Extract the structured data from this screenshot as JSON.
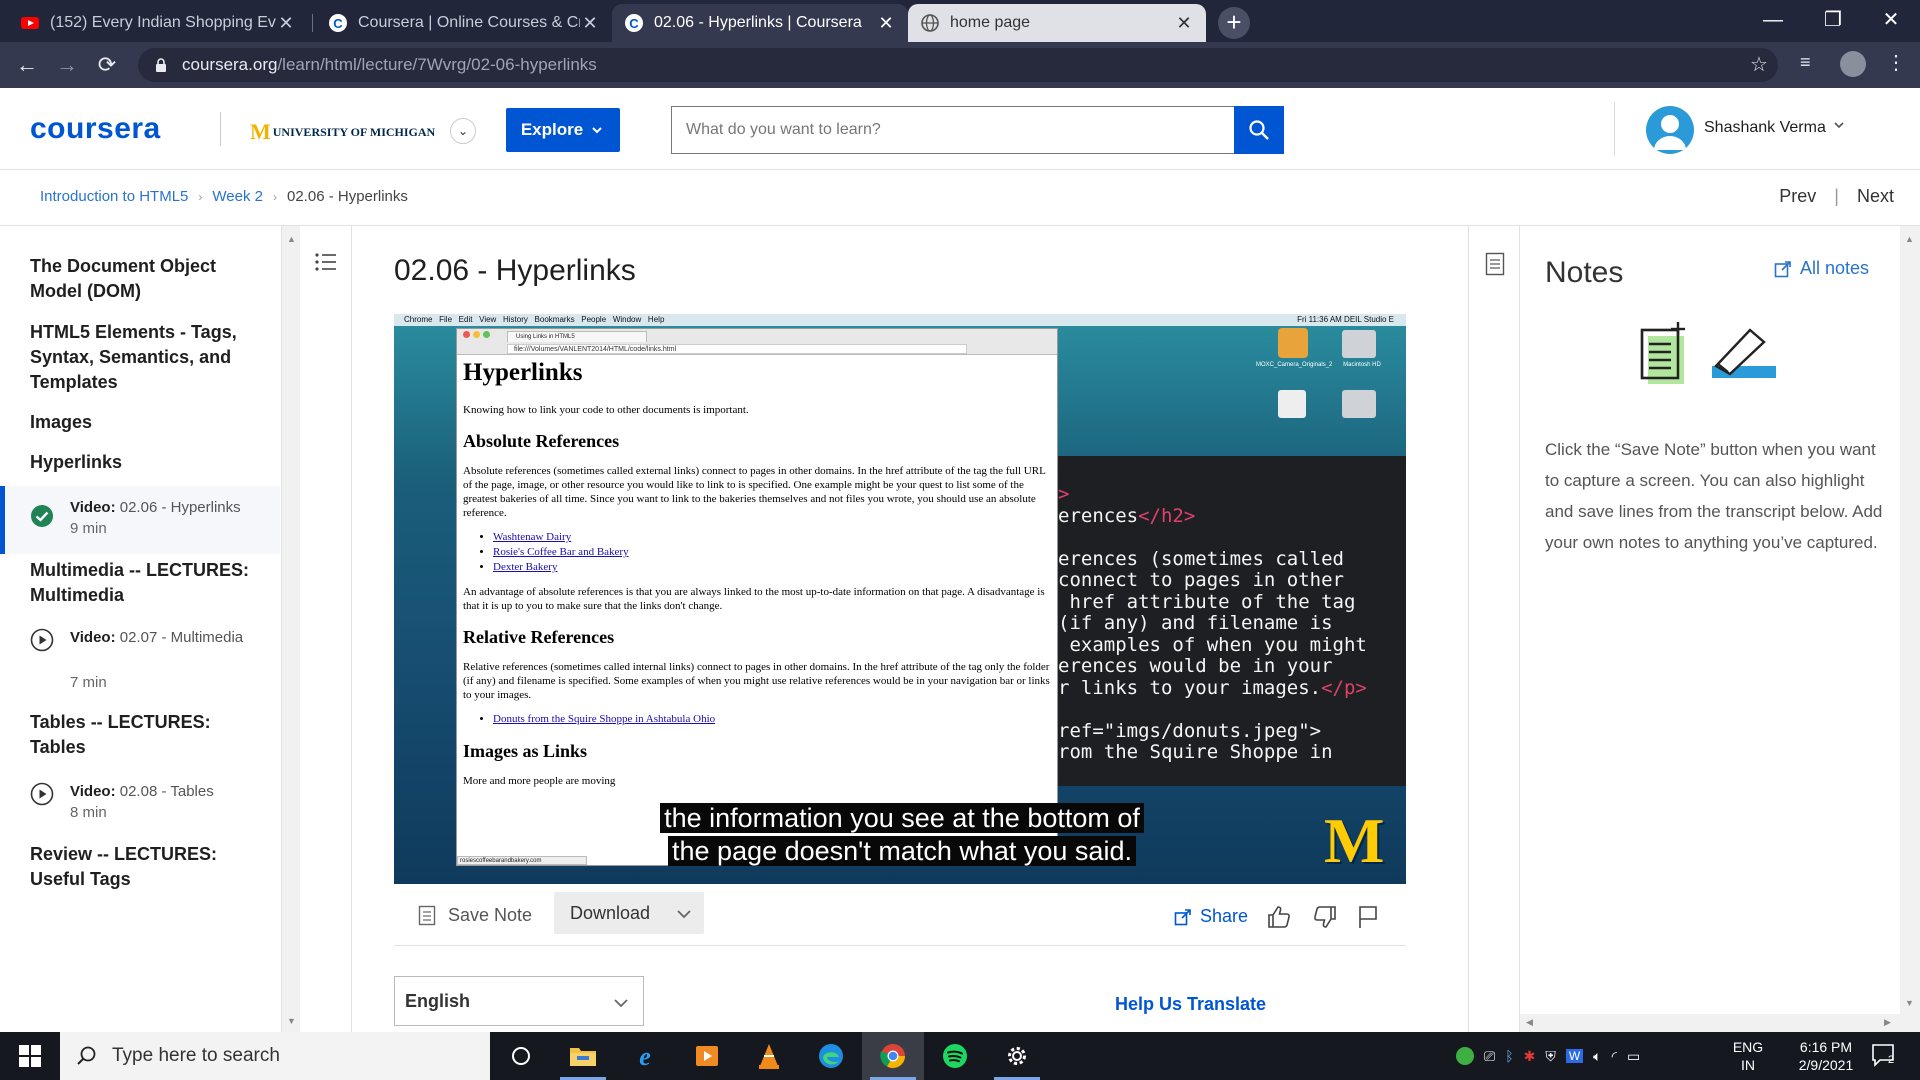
{
  "browser": {
    "tabs": [
      {
        "title": "(152) Every Indian Shopping Ever",
        "state": "inactive"
      },
      {
        "title": "Coursera | Online Courses & Credentials",
        "state": "inactive"
      },
      {
        "title": "02.06 - Hyperlinks | Coursera",
        "state": "active"
      },
      {
        "title": "home page",
        "state": "light"
      }
    ],
    "url_domain": "coursera.org",
    "url_path": "/learn/html/lecture/7Wvrg/02-06-hyperlinks"
  },
  "header": {
    "logo": "coursera",
    "partner_m": "M",
    "partner": "UNIVERSITY OF MICHIGAN",
    "explore_label": "Explore",
    "search_placeholder": "What do you want to learn?",
    "user_name": "Shashank Verma"
  },
  "breadcrumb": {
    "course": "Introduction to HTML5",
    "week": "Week 2",
    "current": "02.06 - Hyperlinks",
    "prev": "Prev",
    "next": "Next"
  },
  "sidebar": {
    "sections": [
      {
        "title": "The Document Object Model (DOM)"
      },
      {
        "title": "HTML5 Elements - Tags, Syntax, Semantics, and Templates"
      },
      {
        "title": "Images"
      },
      {
        "title": "Hyperlinks"
      },
      {
        "title": "Multimedia -- LECTURES: Multimedia"
      },
      {
        "title": "Tables -- LECTURES: Tables"
      },
      {
        "title": "Review -- LECTURES: Useful Tags"
      }
    ],
    "items": [
      {
        "kind": "Video:",
        "name": "02.06 - Hyperlinks",
        "duration": "9 min",
        "status": "completed"
      },
      {
        "kind": "Video:",
        "name": "02.07 - Multimedia",
        "duration": "7 min",
        "status": "play"
      },
      {
        "kind": "Video:",
        "name": "02.08 - Tables",
        "duration": "8 min",
        "status": "play"
      }
    ]
  },
  "main": {
    "title": "02.06 - Hyperlinks",
    "video": {
      "mac_menu": "Chrome   File   Edit   View   History   Bookmarks   People   Window   Help",
      "mac_clock": "Fri 11:36 AM   DEIL Studio E",
      "inner_tab": "Using Links in HTML5",
      "inner_url": "file:///Volumes/VANLENT2014/HTML/code/links.html",
      "page_h1": "Hyperlinks",
      "page_intro": "Knowing how to link your code to other documents is important.",
      "abs_h2": "Absolute References",
      "abs_p": "Absolute references (sometimes called external links) connect to pages in other domains. In the href attribute of the tag the full URL of the page, image, or other resource you would like to link to is specified. One example might be your quest to list some of the greatest bakeries of all time. Since you want to link to the bakeries themselves and not files you wrote, you should use an absolute reference.",
      "abs_links": [
        "Washtenaw Dairy",
        "Rosie's Coffee Bar and Bakery",
        "Dexter Bakery"
      ],
      "abs_p2": "An advantage of absolute references is that you are always linked to the most up-to-date information on that page. A disadvantage is that it is up to you to make sure that the links don't change.",
      "rel_h2": "Relative References",
      "rel_p": "Relative references (sometimes called internal links) connect to pages in other domains. In the href attribute of the tag only the folder (if any) and filename is specified. Some examples of when you might use relative references would be in your navigation bar or links to your images.",
      "rel_links": [
        "Donuts from the Squire Shoppe in Ashtabula Ohio"
      ],
      "img_h2": "Images as Links",
      "img_p": "More and more people are moving",
      "status_url": "rosiescoffeebarandbakery.com",
      "drive1": "MOXC_Camera_Originals_2",
      "drive2": "Macintosh HD",
      "caption_line1": "the information you see at the bottom of",
      "caption_line2": "the page doesn't match what you said.",
      "code_lines": [
        {
          "a": "",
          "tag": ">"
        },
        {
          "a": "erences",
          "tag": "</h2>"
        },
        {
          "a": "",
          "tag": ""
        },
        {
          "a": "erences (sometimes called",
          "tag": ""
        },
        {
          "a": "connect to pages in other",
          "tag": ""
        },
        {
          "a": " href attribute of the tag",
          "tag": ""
        },
        {
          "a": "(if any) and filename is",
          "tag": ""
        },
        {
          "a": " examples of when you might",
          "tag": ""
        },
        {
          "a": "erences would be in your",
          "tag": ""
        },
        {
          "a": "r links to your images.",
          "tag": "</p>"
        },
        {
          "a": "",
          "tag": ""
        },
        {
          "a": "ref=\"imgs/donuts.jpeg\">",
          "tag": ""
        },
        {
          "a": "rom the Squire Shoppe in",
          "tag": ""
        }
      ]
    },
    "save_note": "Save Note",
    "download": "Download",
    "share": "Share",
    "language": "English",
    "help_translate": "Help Us Translate"
  },
  "notes": {
    "title": "Notes",
    "all_notes": "All notes",
    "help_text": "Click the “Save Note” button when you want to capture a screen. You can also highlight and save lines from the transcript below. Add your own notes to anything you’ve captured."
  },
  "taskbar": {
    "search_placeholder": "Type here to search",
    "lang_line1": "ENG",
    "lang_line2": "IN",
    "time": "6:16 PM",
    "date": "2/9/2021",
    "notification_count": "2"
  },
  "colors": {
    "coursera_blue": "#0056d2",
    "link_blue": "#2a73cc",
    "umich_maize": "#ffcb05",
    "complete_green": "#1f8354"
  }
}
